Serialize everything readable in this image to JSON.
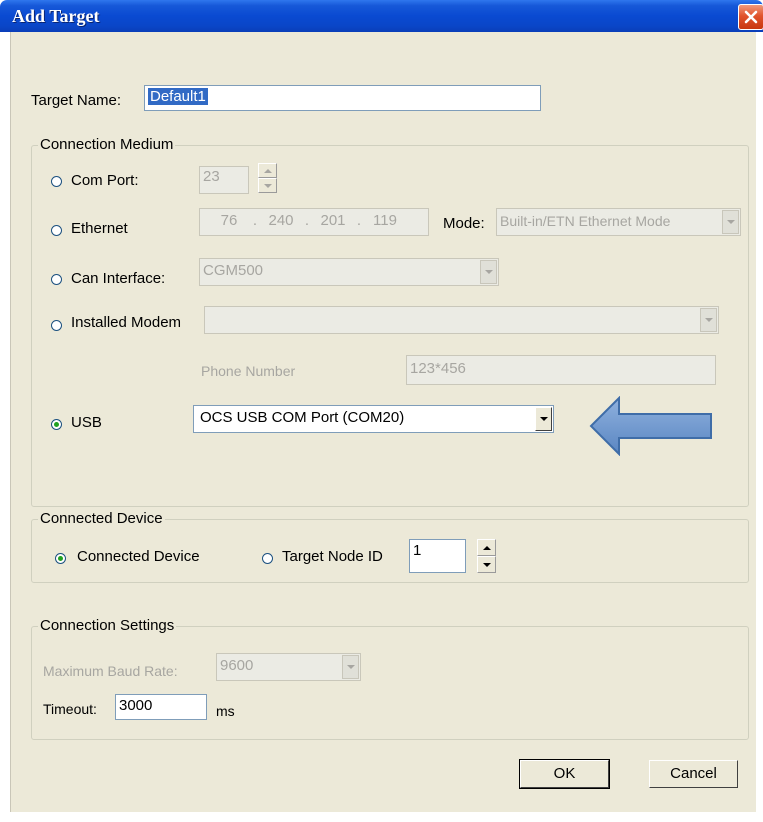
{
  "window": {
    "title": "Add Target"
  },
  "target": {
    "name_label": "Target Name:",
    "name_value": "Default1"
  },
  "connection_medium": {
    "legend": "Connection Medium",
    "com_port": {
      "label": "Com Port:",
      "value": "23"
    },
    "ethernet": {
      "label": "Ethernet",
      "ip": [
        "76",
        "240",
        "201",
        "119"
      ],
      "mode_label": "Mode:",
      "mode_value": "Built-in/ETN Ethernet Mode"
    },
    "can_interface": {
      "label": "Can Interface:",
      "value": "CGM500"
    },
    "installed_modem": {
      "label": "Installed Modem",
      "value": "",
      "phone_label": "Phone Number",
      "phone_value": "123*456"
    },
    "usb": {
      "label": "USB",
      "value": "OCS USB COM Port (COM20)"
    }
  },
  "connected_device": {
    "legend": "Connected Device",
    "option_device": "Connected Device",
    "option_node": "Target Node ID",
    "node_value": "1"
  },
  "connection_settings": {
    "legend": "Connection Settings",
    "baud_label": "Maximum Baud Rate:",
    "baud_value": "9600",
    "timeout_label": "Timeout:",
    "timeout_value": "3000",
    "timeout_unit": "ms"
  },
  "buttons": {
    "ok": "OK",
    "cancel": "Cancel"
  },
  "annotation": {
    "arrow_color": "#6c97cf",
    "arrow_border": "#3f6da8"
  },
  "selected_radio": "usb",
  "icons": [
    "close-icon",
    "dropdown-arrow-icon",
    "spin-up-icon",
    "spin-down-icon",
    "arrow-pointer-icon"
  ]
}
